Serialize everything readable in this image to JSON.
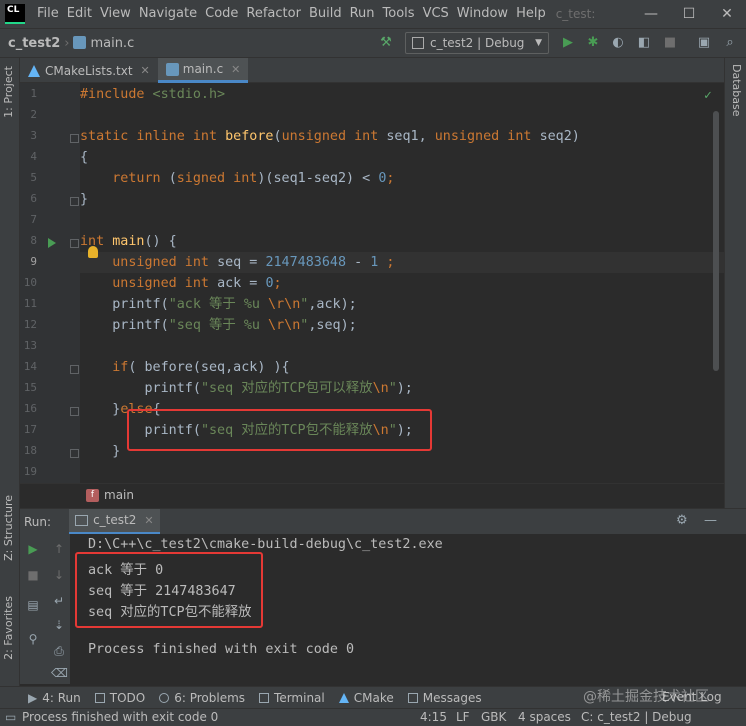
{
  "titlebar": {
    "logo": "CL",
    "menus": [
      "File",
      "Edit",
      "View",
      "Navigate",
      "Code",
      "Refactor",
      "Build",
      "Run",
      "Tools",
      "VCS",
      "Window",
      "Help"
    ],
    "window_title": "c_test:",
    "minimize": "—",
    "maximize": "☐",
    "close": "✕"
  },
  "navbar": {
    "project": "c_test2",
    "separator": "›",
    "file": "main.c",
    "run_config": "c_test2 | Debug",
    "run_config_arrow": "▼"
  },
  "left_strip": {
    "project_tab": "1: Project",
    "structure_tab": "Z: Structure",
    "favorites_tab": "2: Favorites"
  },
  "right_strip": {
    "database_tab": "Database"
  },
  "tabs": [
    {
      "label": "CMakeLists.txt",
      "close": "✕"
    },
    {
      "label": "main.c",
      "close": "✕"
    }
  ],
  "editor": {
    "line_numbers": [
      "1",
      "2",
      "3",
      "4",
      "5",
      "6",
      "7",
      "8",
      "9",
      "10",
      "11",
      "12",
      "13",
      "14",
      "15",
      "16",
      "17",
      "18",
      "19"
    ],
    "current_line": 9,
    "check": "✓",
    "code": {
      "l1": {
        "directive": "#include",
        "header": " <stdio.h>"
      },
      "l3": {
        "kw": "static inline int ",
        "fn": "before",
        "p1": "(",
        "t1": "unsigned int ",
        "a1": "seq1, ",
        "t2": "unsigned int ",
        "a2": "seq2)"
      },
      "l4": "{",
      "l5": {
        "indent": "    ",
        "kw": "return ",
        "p1": "(",
        "t": "signed int",
        "rest": ")(seq1-seq2) < ",
        "num": "0",
        "end": ";"
      },
      "l6": "}",
      "l8": {
        "kw": "int ",
        "fn": "main",
        "rest": "() {"
      },
      "l9": {
        "indent": "    ",
        "kw": "unsigned int ",
        "rest": "seq = ",
        "num1": "2147483648",
        "op": " - ",
        "num2": "1",
        "end": " ;"
      },
      "l10": {
        "indent": "    ",
        "kw": "unsigned int ",
        "rest": "ack = ",
        "num": "0",
        "end": ";"
      },
      "l11": {
        "indent": "    ",
        "fn": "printf(",
        "str": "\"ack 等于 %u ",
        "esc": "\\r\\n",
        "str2": "\"",
        "rest": ",ack);"
      },
      "l12": {
        "indent": "    ",
        "fn": "printf(",
        "str": "\"seq 等于 %u ",
        "esc": "\\r\\n",
        "str2": "\"",
        "rest": ",seq);"
      },
      "l14": {
        "indent": "    ",
        "kw": "if",
        "rest": "( before(seq,ack) ){"
      },
      "l15": {
        "indent": "        ",
        "fn": "printf(",
        "str": "\"seq 对应的TCP包可以释放",
        "esc": "\\n",
        "str2": "\"",
        "rest": ");"
      },
      "l16": {
        "indent": "    ",
        "p1": "}",
        "kw": "else",
        "p2": "{"
      },
      "l17": {
        "indent": "        ",
        "fn": "printf(",
        "str": "\"seq 对应的TCP包不能释放",
        "esc": "\\n",
        "str2": "\"",
        "rest": ");"
      },
      "l18": "    }"
    }
  },
  "code_breadcrumb": {
    "icon": "f",
    "label": "main"
  },
  "run_panel": {
    "label": "Run:",
    "tab": "c_test2",
    "output": [
      "D:\\C++\\c_test2\\cmake-build-debug\\c_test2.exe",
      "ack 等于 0",
      "seq 等于 2147483647",
      "seq 对应的TCP包不能释放",
      "",
      "Process finished with exit code 0"
    ]
  },
  "bottom_tools": [
    {
      "label": "4: Run"
    },
    {
      "label": "TODO"
    },
    {
      "label": "6: Problems"
    },
    {
      "label": "Terminal"
    },
    {
      "label": "CMake"
    },
    {
      "label": "Messages"
    }
  ],
  "watermark": "@稀土掘金技术社区",
  "event_log": "Event Log",
  "status": {
    "message": "Process finished with exit code 0",
    "position": "4:15",
    "line_sep": "LF",
    "encoding": "GBK",
    "indent": "4 spaces",
    "context": "C: c_test2 | Debug"
  },
  "colors": {
    "accent": "#4a88c7",
    "highlight_box": "#e53935",
    "keyword": "#cc7832",
    "string": "#6a8759",
    "number": "#6897bb",
    "function": "#ffc66d"
  }
}
